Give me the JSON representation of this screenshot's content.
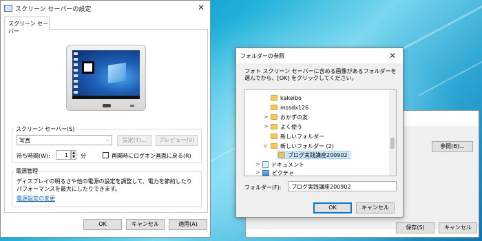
{
  "main_dialog": {
    "title": "スクリーン セーバーの設定",
    "tab": "スクリーン セーバー",
    "saver_group_label": "スクリーン セーバー(S)",
    "saver_selected": "写真",
    "settings_button": "設定(T)...",
    "preview_button": "プレビュー(V)",
    "wait_label": "待ち時間(W):",
    "wait_value": "1",
    "minutes_label": "分",
    "logon_checkbox_label": "再開時にログオン画面に戻る(R)",
    "power_group_label": "電源管理",
    "power_desc": "ディスプレイの明るさや他の電源の設定を調整して、電力を節約したりパフォーマンスを最大にしたりできます。",
    "power_link": "電源設定の変更",
    "ok_button": "OK",
    "cancel_button": "キャンセル",
    "apply_button": "適用(A)"
  },
  "back_dialog": {
    "browse_button": "参照(B)...",
    "save_button": "保存(S)",
    "cancel_button": "キャンセル"
  },
  "browse_dialog": {
    "title": "フォルダーの参照",
    "instruction": "フォト スクリーン セーバーに含める画像があるフォルダーを選んでから、[OK] をクリックしてください。",
    "tree": [
      {
        "label": "kakeibo",
        "expander": ""
      },
      {
        "label": "mssdx126",
        "expander": ""
      },
      {
        "label": "おかずの友",
        "expander": ">"
      },
      {
        "label": "よく使う",
        "expander": ">"
      },
      {
        "label": "新しいフォルダー",
        "expander": ""
      },
      {
        "label": "新しいフォルダー (2)",
        "expander": "v"
      },
      {
        "label": "ブログ実践講座200902",
        "expander": ""
      },
      {
        "label": "ドキュメント",
        "expander": ">"
      },
      {
        "label": "ピクチャ",
        "expander": ">"
      }
    ],
    "folder_label": "フォルダー(F):",
    "folder_value": "ブログ実践講座200902",
    "ok_button": "OK",
    "cancel_button": "キャンセル"
  }
}
